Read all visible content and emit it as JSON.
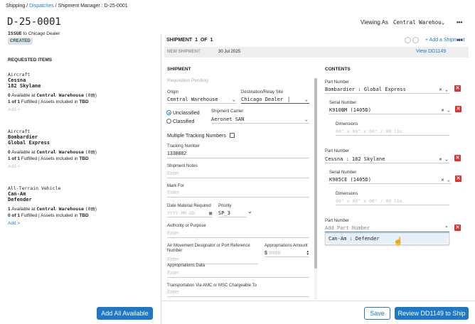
{
  "breadcrumb": {
    "shipping": "Shipping",
    "sep1": " / ",
    "dispatches": "Dispatches",
    "sep2": " / ",
    "current": "Shipment Manager : D-25-0001"
  },
  "header": {
    "title": "D-25-0001",
    "subtitle_issue": "ISSUE",
    "subtitle_rest": " to Chicago Dealer",
    "status": "CREATED",
    "viewing_as_label": "Viewing As",
    "viewing_as_value": "Central Warehou",
    "more": "•••"
  },
  "requested": {
    "heading": "REQUESTED ITEMS",
    "items": [
      {
        "category": "Aircraft",
        "line1": "Cessna",
        "line2": "182 Skylane",
        "avail_count": "0",
        "avail_text": " Available at ",
        "avail_loc": "Central Warehouse",
        "avail_paren": "(0",
        "fulfilled_a": "1 of 1",
        "fulfilled_b": " Fulfilled | Assets included in ",
        "fulfilled_c": "TBD",
        "add": "Add +"
      },
      {
        "category": "Aircraft",
        "line1": "Bombardier",
        "line2": "Global Express",
        "avail_count": "0",
        "avail_text": " Available at ",
        "avail_loc": "Central Warehouse",
        "avail_paren": "(0",
        "fulfilled_a": "1 of 1",
        "fulfilled_b": " Fulfilled | Assets included in ",
        "fulfilled_c": "TBD",
        "add": "Add +"
      },
      {
        "category": "All-Terrain Vehicle",
        "line1": "Can-Am",
        "line2": "Defender",
        "avail_count": "1",
        "avail_text": " Available at ",
        "avail_loc": "Central Warehouse",
        "avail_paren": "(0",
        "fulfilled_a": "0 of 1",
        "fulfilled_b": " Fulfilled | Assets included in ",
        "fulfilled_c": "TBD",
        "add": "Add >"
      }
    ],
    "add_all": "Add All Available"
  },
  "shipment_bar": {
    "label": "SHIPMENT",
    "num": "1",
    "of": "OF",
    "total": "1",
    "add": "+ Add a Shipment",
    "more": "•••"
  },
  "new_shipment": {
    "label": "NEW SHIPMENT",
    "date": "30 Jul 2025",
    "view": "View DD1149"
  },
  "shipment": {
    "heading": "SHIPMENT",
    "status": "Requisition Pending",
    "origin_label": "Origin",
    "origin_value": "Central Warehouse",
    "dest_label": "Destination/Relay Site",
    "dest_value": "Chicago Dealer",
    "unclassified": "Unclassified",
    "classified": "Classified",
    "carrier_label": "Shipment Carrier",
    "carrier_value": "Aeronet SAN",
    "multi_tracking": "Multiple Tracking Numbers",
    "tracking_label": "Tracking Number",
    "tracking_value": "1338882",
    "notes_label": "Shipment Notes",
    "notes_ph": "Enter",
    "markfor_label": "Mark For",
    "markfor_ph": "Enter",
    "date_label": "Date Material Required",
    "date_ph": "YYYY-MM-DD",
    "priority_label": "Priority",
    "priority_value": "SP_3",
    "authority_label": "Authority or Purpose",
    "authority_ph": "Enter",
    "airmove_label": "Air Movement Designator or Port Reference Number",
    "airmove_ph": "Enter",
    "approp_amt_label": "Appropriations Amount",
    "approp_amt_prefix": "$",
    "approp_amt_ph": "0000",
    "approp_data_label": "Appropriations Data",
    "approp_data_ph": "Enter",
    "transport_label": "Transportation Via AMC or MSC Chargeable To",
    "transport_ph": "Enter"
  },
  "contents": {
    "heading": "CONTENTS",
    "items": [
      {
        "part_label": "Part Number",
        "part_value": "Bombardier : Global Express",
        "serial_label": "Serial Number",
        "serial_value": "K910BM (1405D)",
        "dim_label": "Dimensions",
        "dim_ph": "00\" x 00\" x 00\" / 00 lbs."
      },
      {
        "part_label": "Part Number",
        "part_value": "Cessna : 182 Skylane",
        "serial_label": "Serial Number",
        "serial_value": "K905CE (1405D)",
        "dim_label": "Dimensions",
        "dim_ph": "00\" x 00\" x 00\" / 00 lbs."
      }
    ],
    "new_part_label": "Part Number",
    "new_part_ph": "Add Part Number",
    "option": "Can-Am : Defender"
  },
  "footer": {
    "save": "Save",
    "review": "Review DD1149 to Ship"
  },
  "colors": {
    "accent": "#1e78c8",
    "danger": "#e03030",
    "badge_bg": "#dde3ea"
  }
}
